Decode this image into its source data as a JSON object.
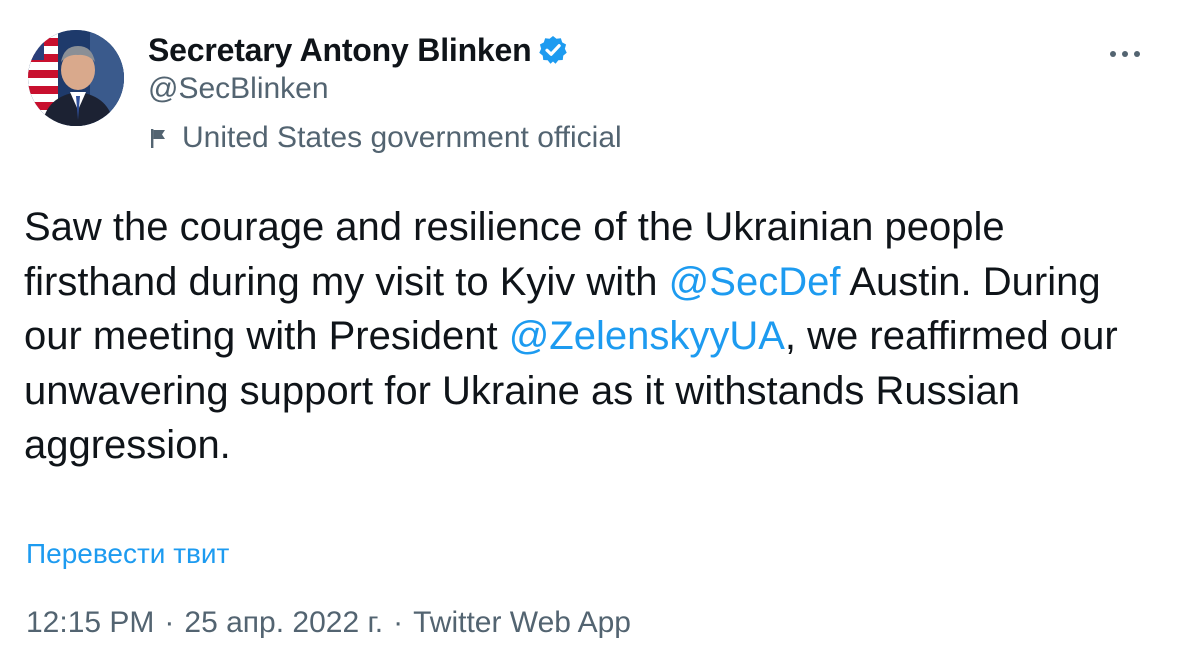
{
  "author": {
    "display_name": "Secretary Antony Blinken",
    "handle": "@SecBlinken",
    "label": "United States government official",
    "verified": true
  },
  "tweet": {
    "text_1": "Saw the courage and resilience of the Ukrainian people firsthand during my visit to Kyiv with ",
    "mention_1": "@SecDef",
    "text_2": " Austin. During our meeting with President ",
    "mention_2": "@ZelenskyyUA",
    "text_3": ", we reaffirmed our unwavering support for Ukraine as it withstands Russian aggression."
  },
  "translate_label": "Перевести твит",
  "meta": {
    "time": "12:15 PM",
    "separator": "·",
    "date": "25 апр. 2022 г.",
    "source": "Twitter Web App"
  },
  "icons": {
    "verified": "verified-badge-icon",
    "label": "flag-icon",
    "more": "more-icon"
  },
  "colors": {
    "accent": "#1d9bf0",
    "text": "#0f1419",
    "secondary": "#536471"
  }
}
